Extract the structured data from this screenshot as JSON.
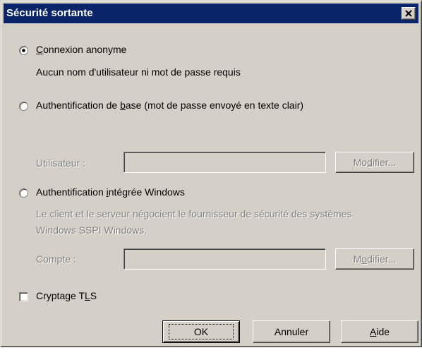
{
  "window": {
    "title": "Sécurité sortante",
    "close_glyph": "×"
  },
  "options": {
    "anonymous": {
      "label": "Connexion anonyme",
      "description": "Aucun nom d'utilisateur ni mot de passe requis",
      "checked": true
    },
    "basic": {
      "label": "Authentification de base (mot de passe envoyé en texte clair)",
      "checked": false
    },
    "basic_user": {
      "label": "Utilisateur :",
      "value": "",
      "button": "Modifier..."
    },
    "integrated": {
      "label": "Authentification intégrée Windows",
      "description_line1": "Le client et le serveur négocient le fournisseur de sécurité des systèmes",
      "description_line2": "Windows SSPI Windows.",
      "checked": false
    },
    "integrated_account": {
      "label": "Compte :",
      "value": "",
      "button": "Modifier..."
    },
    "tls": {
      "label": "Cryptage TLS",
      "checked": false
    }
  },
  "buttons": {
    "ok": "OK",
    "cancel": "Annuler",
    "help": "Aide"
  },
  "colors": {
    "face": "#d4d0c8",
    "titlebar": "#0a246a",
    "disabled_text": "#808080"
  }
}
